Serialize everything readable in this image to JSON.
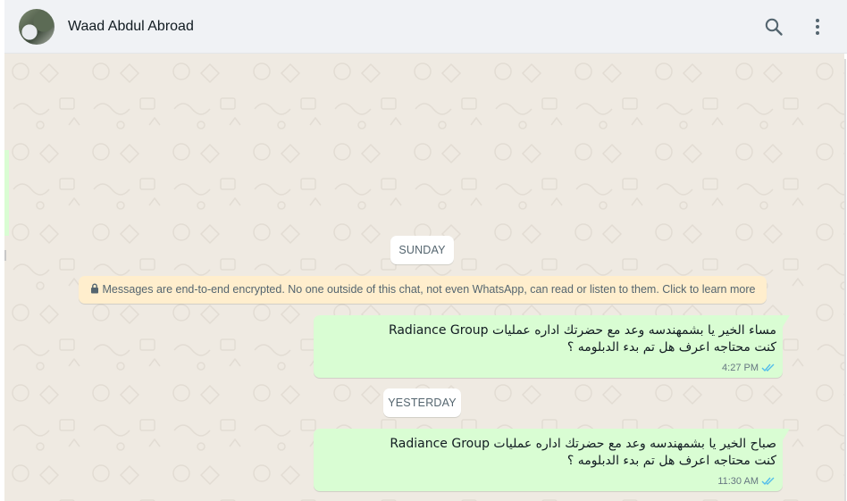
{
  "header": {
    "contact_name": "Waad Abdul Abroad",
    "icons": [
      "avatar",
      "search-icon",
      "menu-icon"
    ]
  },
  "chat": {
    "day_labels": [
      "SUNDAY",
      "YESTERDAY"
    ],
    "encryption_notice": "Messages are end-to-end encrypted. No one outside of this chat, not even WhatsApp, can read or listen to them. Click to learn more",
    "messages": [
      {
        "direction": "outgoing",
        "lines": [
          "مساء الخير يا بشمهندسه وعد مع حضرتك اداره عمليات Radiance Group",
          "كنت محتاجه اعرف هل تم بدء الدبلومه ؟"
        ],
        "time": "4:27 PM",
        "status": "read"
      },
      {
        "direction": "outgoing",
        "lines": [
          "صباح الخير يا بشمهندسه وعد مع حضرتك اداره عمليات Radiance Group",
          "كنت محتاجه اعرف هل تم بدء الدبلومه ؟"
        ],
        "time": "11:30 AM",
        "status": "read"
      }
    ]
  },
  "colors": {
    "header_bg": "#f0f2f5",
    "chat_bg": "#efeae2",
    "outgoing_bubble": "#d9fdd3",
    "notice_bg": "#ffeecd",
    "read_ticks": "#53bdeb",
    "text_primary": "#111b21",
    "text_secondary": "#667781"
  }
}
